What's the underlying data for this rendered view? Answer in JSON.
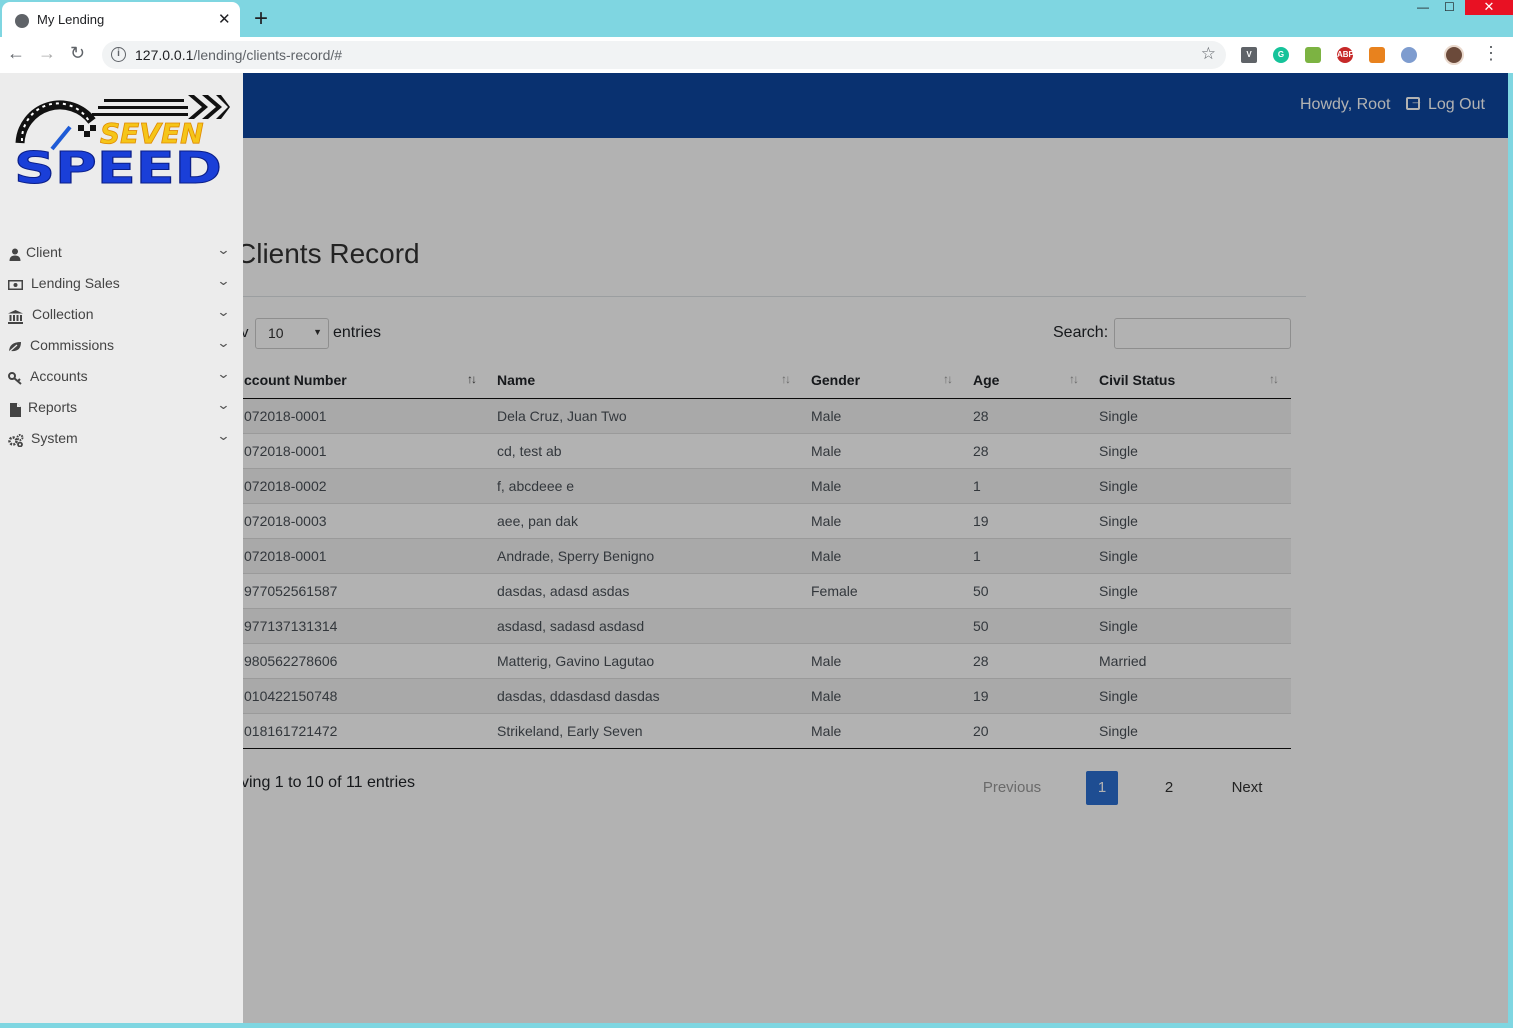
{
  "browser": {
    "tab_title": "My Lending",
    "url_host": "127.0.0.1",
    "url_path": "/lending/clients-record/#"
  },
  "header": {
    "greeting": "Howdy, Root",
    "logout_label": "Log Out"
  },
  "logo": {
    "line1": "SEVEN",
    "line2": "SPEED"
  },
  "sidebar": {
    "items": [
      {
        "label": "Client",
        "icon": "user-icon"
      },
      {
        "label": "Lending Sales",
        "icon": "money-icon"
      },
      {
        "label": "Collection",
        "icon": "bank-icon"
      },
      {
        "label": "Commissions",
        "icon": "leaf-icon"
      },
      {
        "label": "Accounts",
        "icon": "key-icon"
      },
      {
        "label": "Reports",
        "icon": "file-icon"
      },
      {
        "label": "System",
        "icon": "cogs-icon"
      }
    ]
  },
  "page": {
    "title": "Clients Record"
  },
  "table_controls": {
    "show_label": "v",
    "length_value": "10",
    "entries_label": "entries",
    "search_label": "Search:",
    "search_value": ""
  },
  "table": {
    "columns": [
      "ccount Number",
      "Name",
      "Gender",
      "Age",
      "Civil Status"
    ],
    "rows": [
      [
        "072018-0001",
        "Dela Cruz, Juan Two",
        "Male",
        "28",
        "Single"
      ],
      [
        "072018-0001",
        "cd, test ab",
        "Male",
        "28",
        "Single"
      ],
      [
        "072018-0002",
        "f, abcdeee e",
        "Male",
        "1",
        "Single"
      ],
      [
        "072018-0003",
        "aee, pan dak",
        "Male",
        "19",
        "Single"
      ],
      [
        "072018-0001",
        "Andrade, Sperry Benigno",
        "Male",
        "1",
        "Single"
      ],
      [
        "977052561587",
        "dasdas, adasd asdas",
        "Female",
        "50",
        "Single"
      ],
      [
        "977137131314",
        "asdasd, sadasd asdasd",
        "",
        "50",
        "Single"
      ],
      [
        "980562278606",
        "Matterig, Gavino Lagutao",
        "Male",
        "28",
        "Married"
      ],
      [
        "010422150748",
        "dasdas, ddasdasd dasdas",
        "Male",
        "19",
        "Single"
      ],
      [
        "018161721472",
        "Strikeland, Early Seven",
        "Male",
        "20",
        "Single"
      ]
    ]
  },
  "footer": {
    "info": "ving 1 to 10 of 11 entries",
    "previous": "Previous",
    "page1": "1",
    "page2": "2",
    "next": "Next"
  },
  "colors": {
    "header_blue": "#0d47a1",
    "active_page": "#2c6fd1",
    "sidebar_bg": "#ececec",
    "chrome_bg": "#7fd6e1"
  }
}
